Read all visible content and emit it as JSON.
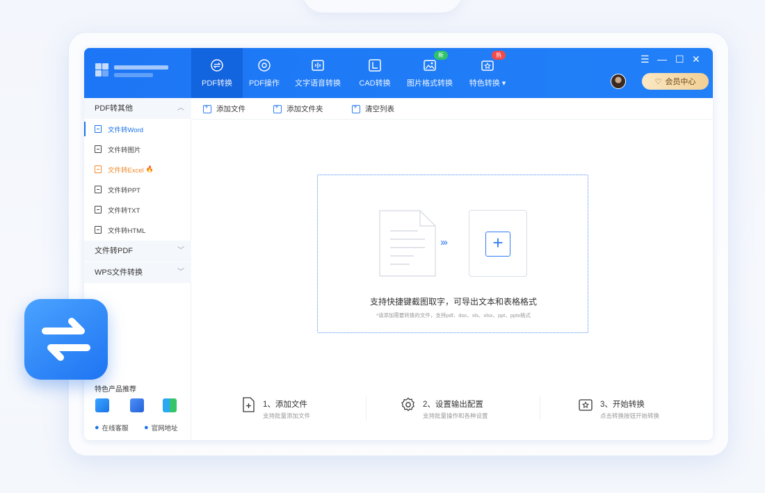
{
  "colors": {
    "brand": "#1d76f5",
    "active_tab": "#1364df",
    "accent": "#1a73e8",
    "hot": "#f0892c",
    "vip_bg": "#f1cf94"
  },
  "header": {
    "tabs": [
      {
        "label": "PDF转换",
        "icon": "convert-icon",
        "active": true
      },
      {
        "label": "PDF操作",
        "icon": "disc-icon"
      },
      {
        "label": "文字语音转换",
        "icon": "audio-wave-icon"
      },
      {
        "label": "CAD转换",
        "icon": "cad-icon"
      },
      {
        "label": "图片格式转换",
        "icon": "image-icon",
        "badge": "新"
      },
      {
        "label": "特色转换 ▾",
        "icon": "star-box-icon",
        "badge": "热"
      }
    ],
    "window_controls": {
      "menu": "☰",
      "minimize": "—",
      "maximize": "☐",
      "close": "✕"
    },
    "vip_label": "会员中心"
  },
  "sidebar": {
    "group1": "PDF转其他",
    "items": [
      {
        "label": "文件转Word",
        "active": true
      },
      {
        "label": "文件转图片"
      },
      {
        "label": "文件转Excel",
        "hot": true
      },
      {
        "label": "文件转PPT"
      },
      {
        "label": "文件转TXT"
      },
      {
        "label": "文件转HTML"
      }
    ],
    "group2": "文件转PDF",
    "group3": "WPS文件转换",
    "recommend_title": "特色产品推荐",
    "link_service": "在线客服",
    "link_site": "官网地址"
  },
  "toolbar": {
    "add_file": "添加文件",
    "add_folder": "添加文件夹",
    "clear_list": "清空列表"
  },
  "dropzone": {
    "title": "支持快捷键截图取字，可导出文本和表格格式",
    "subtitle": "*请添加需要转换的文件，支持pdf、doc、xls、xlsx、ppt、pptx格式"
  },
  "steps": [
    {
      "title": "1、添加文件",
      "subtitle": "支持批量添加文件"
    },
    {
      "title": "2、设置输出配置",
      "subtitle": "支持批量操作和各种设置"
    },
    {
      "title": "3、开始转换",
      "subtitle": "点击转换按钮开始转换"
    }
  ]
}
